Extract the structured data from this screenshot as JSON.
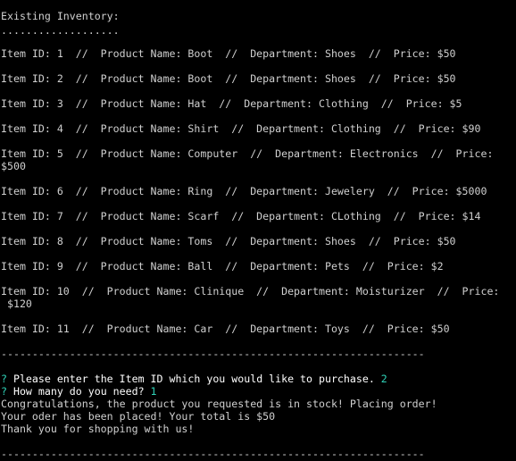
{
  "terminal": {
    "header": "Existing Inventory:",
    "dots": "...................",
    "items": [
      {
        "line": "Item ID: 1  //  Product Name: Boot  //  Department: Shoes  //  Price: $50"
      },
      {
        "line": "Item ID: 2  //  Product Name: Boot  //  Department: Shoes  //  Price: $50"
      },
      {
        "line": "Item ID: 3  //  Product Name: Hat  //  Department: Clothing  //  Price: $5"
      },
      {
        "line": "Item ID: 4  //  Product Name: Shirt  //  Department: Clothing  //  Price: $90"
      },
      {
        "line": "Item ID: 5  //  Product Name: Computer  //  Department: Electronics  //  Price:",
        "wrap": "$500"
      },
      {
        "line": "Item ID: 6  //  Product Name: Ring  //  Department: Jewelery  //  Price: $5000"
      },
      {
        "line": "Item ID: 7  //  Product Name: Scarf  //  Department: CLothing  //  Price: $14"
      },
      {
        "line": "Item ID: 8  //  Product Name: Toms  //  Department: Shoes  //  Price: $50"
      },
      {
        "line": "Item ID: 9  //  Product Name: Ball  //  Department: Pets  //  Price: $2"
      },
      {
        "line": "Item ID: 10  //  Product Name: Clinique  //  Department: Moisturizer  //  Price:",
        "wrap": " $120"
      },
      {
        "line": "Item ID: 11  //  Product Name: Car  //  Department: Toys  //  Price: $50"
      }
    ],
    "divider": "--------------------------------------------------------------------",
    "prompts": [
      {
        "mark": "?",
        "question": "Please enter the Item ID which you would like to purchase.",
        "answer": "2"
      },
      {
        "mark": "?",
        "question": "How many do you need?",
        "answer": "1"
      }
    ],
    "messages": [
      "Congratulations, the product you requested is in stock! Placing order!",
      "Your oder has been placed! Your total is $50",
      "Thank you for shopping with us!"
    ],
    "colors": {
      "background": "#000000",
      "text": "#d0d0d0",
      "accent": "#2fd3b8"
    }
  }
}
